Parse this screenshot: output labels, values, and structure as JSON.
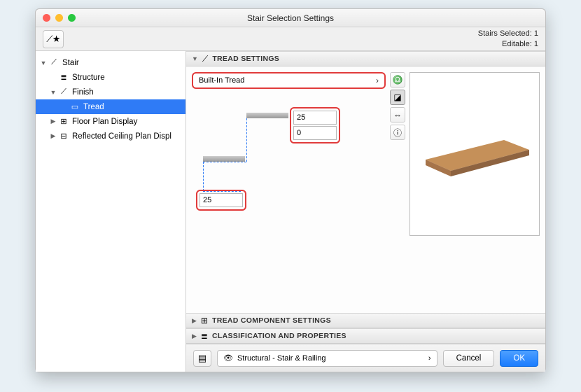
{
  "window": {
    "title": "Stair Selection Settings"
  },
  "header": {
    "selected_label": "Stairs Selected:",
    "selected_count": "1",
    "editable_label": "Editable:",
    "editable_count": "1"
  },
  "tree": {
    "stair": "Stair",
    "structure": "Structure",
    "finish": "Finish",
    "tread": "Tread",
    "floorplan": "Floor Plan Display",
    "rcp": "Reflected Ceiling Plan Displ"
  },
  "panels": {
    "tread_settings": "TREAD SETTINGS",
    "tread_component": "TREAD COMPONENT SETTINGS",
    "classification": "CLASSIFICATION AND PROPERTIES"
  },
  "tread": {
    "dropdown": "Built-In Tread",
    "thickness": "25",
    "nosing": "0",
    "thickness2": "25"
  },
  "footer": {
    "layer": "Structural - Stair & Railing",
    "cancel": "Cancel",
    "ok": "OK"
  }
}
